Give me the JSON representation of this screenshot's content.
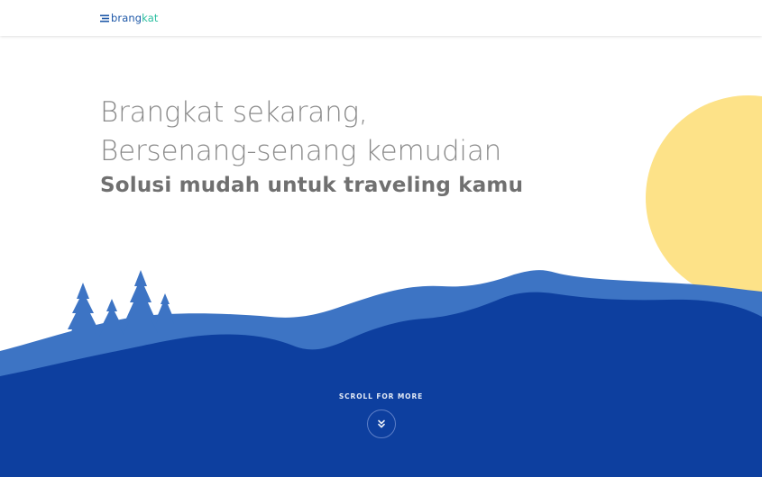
{
  "nav": {
    "logo_part1": "brang",
    "logo_part2": "kat"
  },
  "hero": {
    "line1": "Brangkat sekarang,",
    "line2": "Bersenang-senang kemudian",
    "subtitle": "Solusi mudah untuk traveling kamu"
  },
  "scroll": {
    "label": "SCROLL FOR MORE",
    "icon": "double-chevron-down-icon"
  },
  "colors": {
    "sun": "#fde288",
    "hill_light": "#3d74c4",
    "hill_dark": "#0d3f9f",
    "logo_blue": "#1e58a8",
    "logo_green": "#2bbfa0",
    "heading": "#8a8a8a",
    "subheading": "#707070"
  }
}
